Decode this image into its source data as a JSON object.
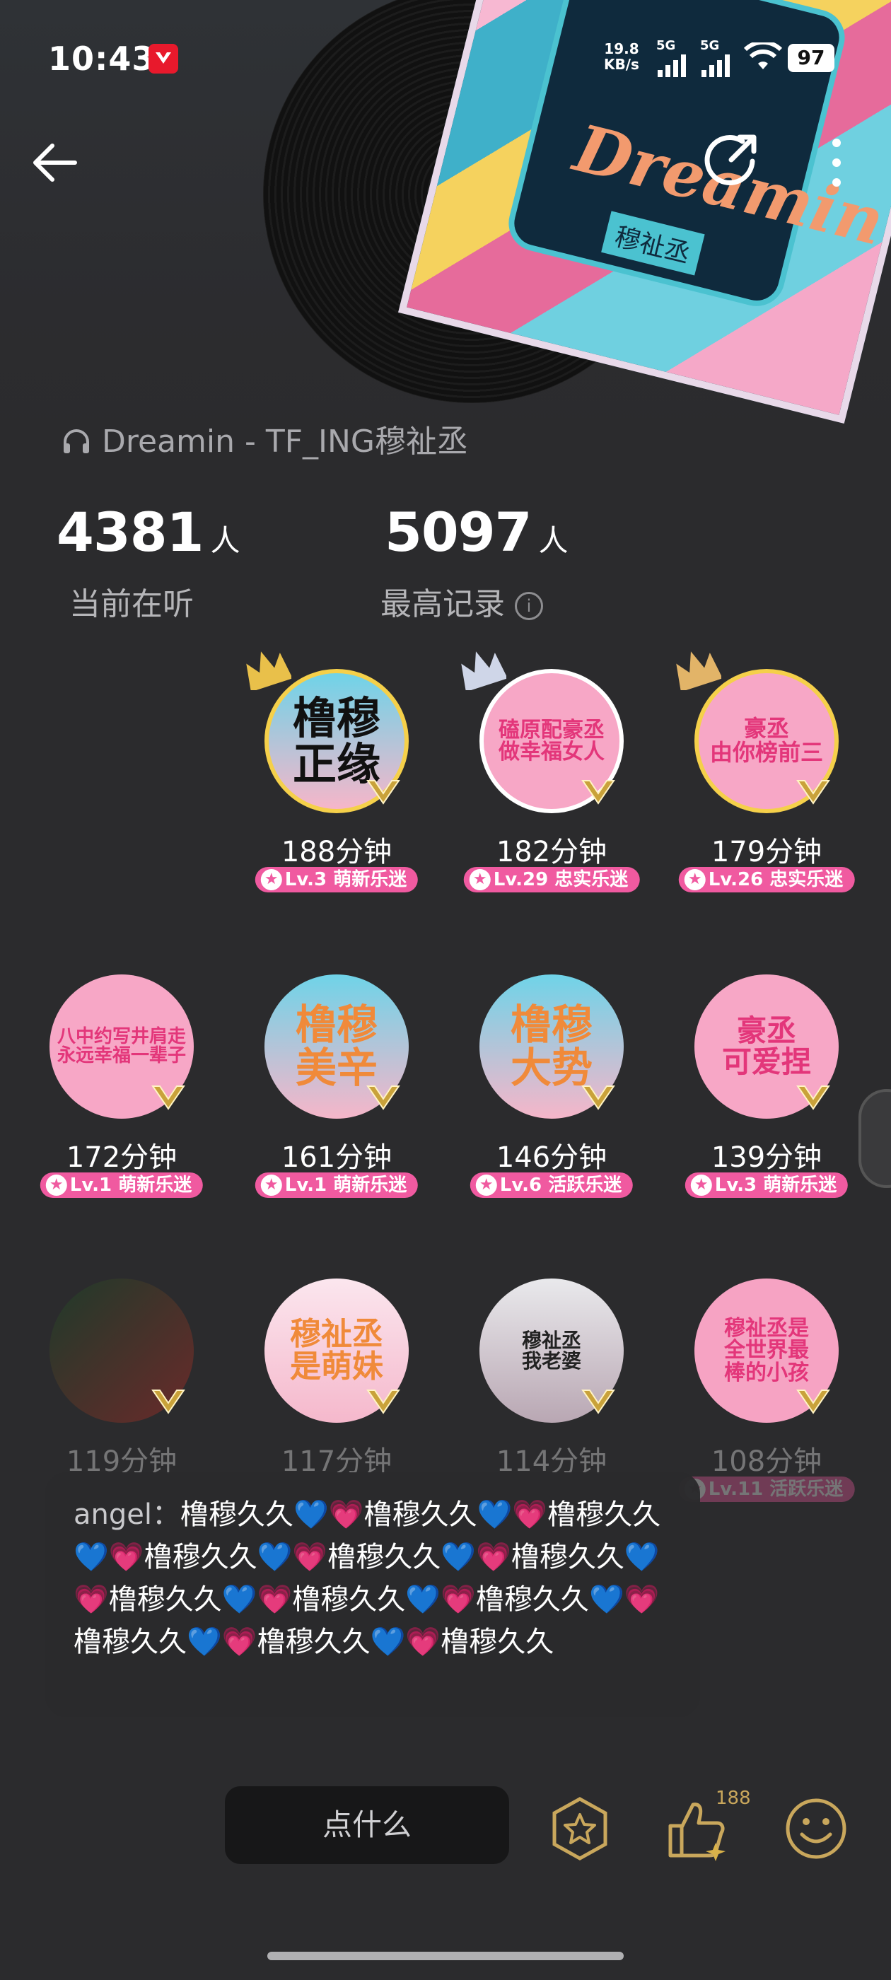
{
  "status": {
    "time": "10:43",
    "net_speed": "19.8",
    "net_unit": "KB/s",
    "sig1": "5G",
    "sig2": "5G",
    "battery": "97"
  },
  "header": {
    "song": "Dreamin - TF_ING穆祉丞",
    "cover_title": "Dreamin",
    "cover_artist": "穆祉丞"
  },
  "stats": {
    "current": {
      "value": "4381",
      "unit": "人",
      "label": "当前在听"
    },
    "record": {
      "value": "5097",
      "unit": "人",
      "label": "最高记录"
    }
  },
  "listeners": [
    {
      "avatar_text": "橹穆\n正缘",
      "minutes": "188分钟",
      "level": "Lv.3 萌新乐迷",
      "crown": "gold"
    },
    {
      "avatar_text": "磕原配豪丞\n做幸福女人",
      "minutes": "182分钟",
      "level": "Lv.29 忠实乐迷",
      "crown": "silver"
    },
    {
      "avatar_text": "豪丞\n由你榜前三",
      "minutes": "179分钟",
      "level": "Lv.26 忠实乐迷",
      "crown": "bronze"
    },
    {
      "avatar_text": "八中约写井肩走\n永远幸福一辈子",
      "minutes": "172分钟",
      "level": "Lv.1 萌新乐迷"
    },
    {
      "avatar_text": "橹穆\n美辛",
      "minutes": "161分钟",
      "level": "Lv.1 萌新乐迷"
    },
    {
      "avatar_text": "橹穆\n大势",
      "minutes": "146分钟",
      "level": "Lv.6 活跃乐迷"
    },
    {
      "avatar_text": "豪丞\n可爱捏",
      "minutes": "139分钟",
      "level": "Lv.3 萌新乐迷"
    },
    {
      "avatar_text": "",
      "minutes": "119分钟",
      "level": ""
    },
    {
      "avatar_text": "穆祉丞\n是萌妹",
      "minutes": "117分钟",
      "level": ""
    },
    {
      "avatar_text": "穆祉丞\n我老婆",
      "minutes": "114分钟",
      "level": ""
    },
    {
      "avatar_text": "穆祉丞是\n全世界最\n棒的小孩",
      "minutes": "108分钟",
      "level": "Lv.11 活跃乐迷"
    }
  ],
  "comment": {
    "user": "angel",
    "text": "橹穆久久💙💗橹穆久久💙💗橹穆久久💙💗橹穆久久💙💗橹穆久久💙💗橹穆久久💙💗橹穆久久💙💗橹穆久久💙💗橹穆久久💙💗橹穆久久💙💗橹穆久久💙💗橹穆久久"
  },
  "bottom": {
    "input_placeholder": "点什么",
    "like_count": "188"
  },
  "colors": {
    "level_badge": "#f05aa0",
    "bg": "#2b2b2d",
    "gold": "#d9b24a"
  }
}
